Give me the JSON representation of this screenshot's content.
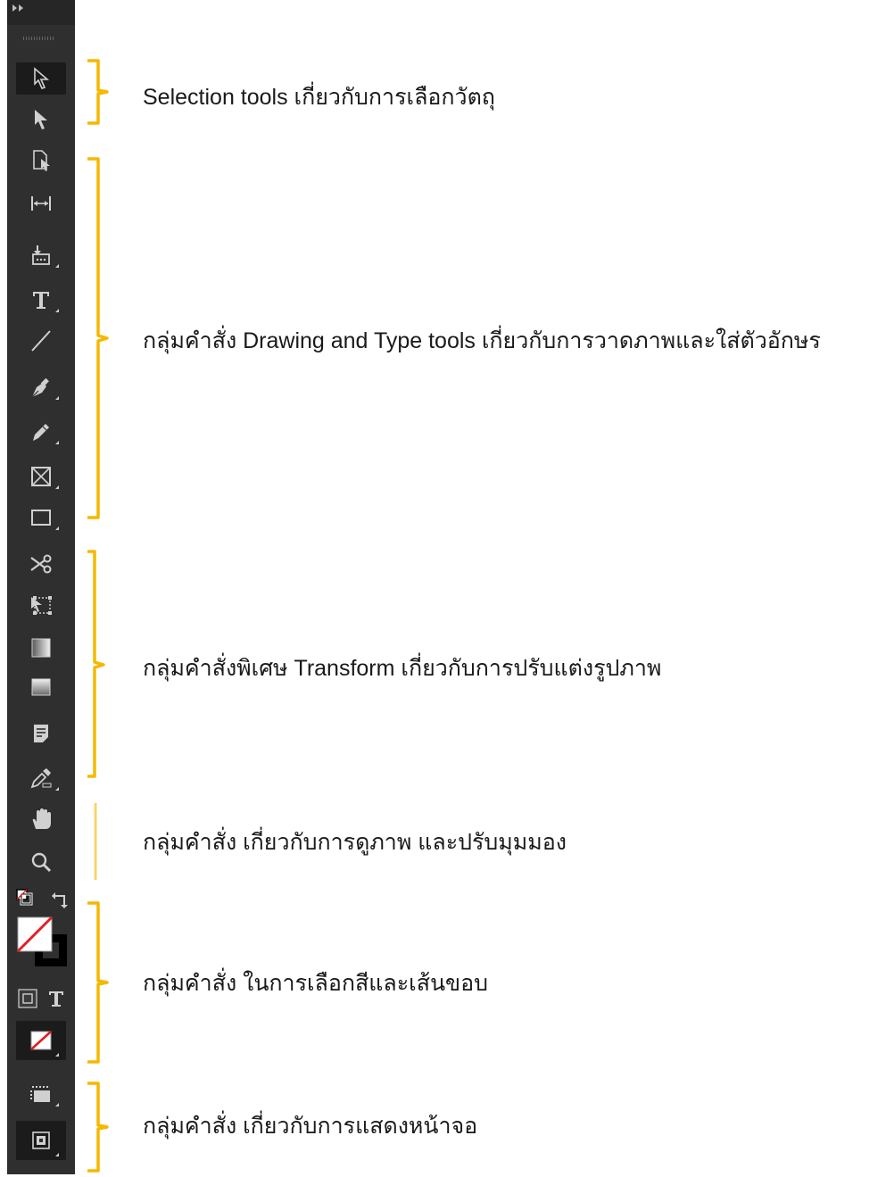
{
  "annotations": [
    {
      "label": "Selection tools เกี่ยวกับการเลือกวัตถุ"
    },
    {
      "label": "กลุ่มคำสั่ง Drawing and Type tools เกี่ยวกับการวาดภาพและใส่ตัวอักษร"
    },
    {
      "label": "กลุ่มคำสั่งพิเศษ Transform เกี่ยวกับการปรับแต่งรูปภาพ"
    },
    {
      "label": "กลุ่มคำสั่ง เกี่ยวกับการดูภาพ และปรับมุมมอง"
    },
    {
      "label": "กลุ่มคำสั่ง ในการเลือกสีและเส้นขอบ"
    },
    {
      "label": "กลุ่มคำสั่ง เกี่ยวกับการแสดงหน้าจอ"
    }
  ],
  "colors": {
    "toolbar_bg": "#2f2f2f",
    "bracket": "#f5b800",
    "bracket_light": "#f9d36a",
    "icon": "#cfcfcf"
  },
  "tools": [
    {
      "icon": "selection-tool-icon"
    },
    {
      "icon": "direct-selection-tool-icon"
    },
    {
      "icon": "page-tool-icon"
    },
    {
      "icon": "gap-tool-icon"
    },
    {
      "icon": "content-collector-icon"
    },
    {
      "icon": "type-tool-icon"
    },
    {
      "icon": "line-tool-icon"
    },
    {
      "icon": "pen-tool-icon"
    },
    {
      "icon": "pencil-tool-icon"
    },
    {
      "icon": "rectangle-frame-tool-icon"
    },
    {
      "icon": "rectangle-tool-icon"
    },
    {
      "icon": "scissors-tool-icon"
    },
    {
      "icon": "free-transform-tool-icon"
    },
    {
      "icon": "gradient-swatch-tool-icon"
    },
    {
      "icon": "gradient-feather-tool-icon"
    },
    {
      "icon": "note-tool-icon"
    },
    {
      "icon": "eyedropper-tool-icon"
    },
    {
      "icon": "hand-tool-icon"
    },
    {
      "icon": "zoom-tool-icon"
    },
    {
      "icon": "default-fill-stroke-icon"
    },
    {
      "icon": "swap-fill-stroke-icon"
    },
    {
      "icon": "fill-stroke-swatch-icon"
    },
    {
      "icon": "formatting-container-icon"
    },
    {
      "icon": "formatting-text-icon"
    },
    {
      "icon": "apply-none-icon"
    },
    {
      "icon": "screen-mode-icon"
    },
    {
      "icon": "view-mode-icon"
    }
  ]
}
